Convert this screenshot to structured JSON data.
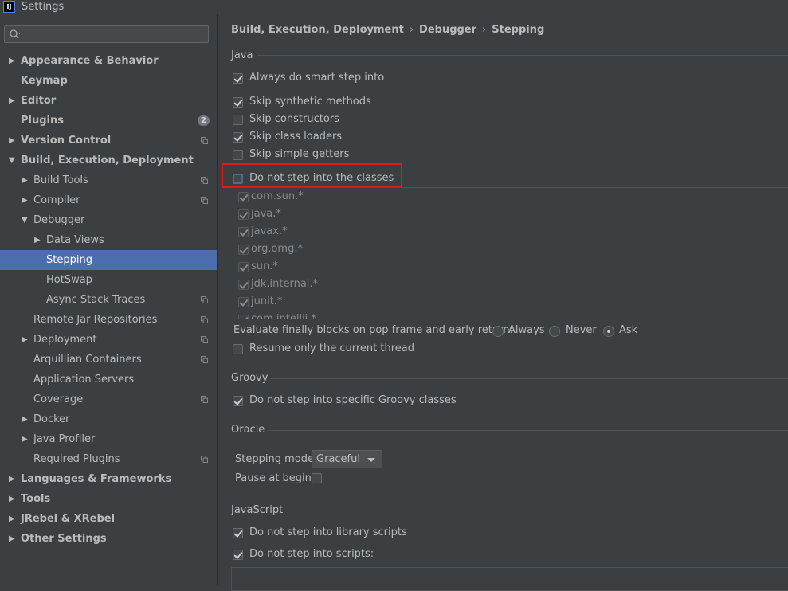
{
  "window": {
    "title": "Settings",
    "app_icon": "IJ"
  },
  "search": {
    "placeholder": ""
  },
  "sidebar": {
    "items": [
      {
        "label": "Appearance & Behavior",
        "bold": true,
        "arrow": "▶",
        "level": 0
      },
      {
        "label": "Keymap",
        "bold": true,
        "arrow": "",
        "level": 0
      },
      {
        "label": "Editor",
        "bold": true,
        "arrow": "▶",
        "level": 0
      },
      {
        "label": "Plugins",
        "bold": true,
        "arrow": "",
        "level": 0,
        "badge": "2"
      },
      {
        "label": "Version Control",
        "bold": true,
        "arrow": "▶",
        "level": 0,
        "copy": true
      },
      {
        "label": "Build, Execution, Deployment",
        "bold": true,
        "arrow": "▼",
        "level": 0
      },
      {
        "label": "Build Tools",
        "bold": false,
        "arrow": "▶",
        "level": 1,
        "copy": true
      },
      {
        "label": "Compiler",
        "bold": false,
        "arrow": "▶",
        "level": 1,
        "copy": true
      },
      {
        "label": "Debugger",
        "bold": false,
        "arrow": "▼",
        "level": 1
      },
      {
        "label": "Data Views",
        "bold": false,
        "arrow": "▶",
        "level": 2
      },
      {
        "label": "Stepping",
        "bold": false,
        "arrow": "",
        "level": 2,
        "selected": true
      },
      {
        "label": "HotSwap",
        "bold": false,
        "arrow": "",
        "level": 2
      },
      {
        "label": "Async Stack Traces",
        "bold": false,
        "arrow": "",
        "level": 2,
        "copy": true
      },
      {
        "label": "Remote Jar Repositories",
        "bold": false,
        "arrow": "",
        "level": 1,
        "copy": true
      },
      {
        "label": "Deployment",
        "bold": false,
        "arrow": "▶",
        "level": 1,
        "copy": true
      },
      {
        "label": "Arquillian Containers",
        "bold": false,
        "arrow": "",
        "level": 1,
        "copy": true
      },
      {
        "label": "Application Servers",
        "bold": false,
        "arrow": "",
        "level": 1
      },
      {
        "label": "Coverage",
        "bold": false,
        "arrow": "",
        "level": 1,
        "copy": true
      },
      {
        "label": "Docker",
        "bold": false,
        "arrow": "▶",
        "level": 1
      },
      {
        "label": "Java Profiler",
        "bold": false,
        "arrow": "▶",
        "level": 1
      },
      {
        "label": "Required Plugins",
        "bold": false,
        "arrow": "",
        "level": 1,
        "copy": true
      },
      {
        "label": "Languages & Frameworks",
        "bold": true,
        "arrow": "▶",
        "level": 0
      },
      {
        "label": "Tools",
        "bold": true,
        "arrow": "▶",
        "level": 0
      },
      {
        "label": "JRebel & XRebel",
        "bold": true,
        "arrow": "▶",
        "level": 0
      },
      {
        "label": "Other Settings",
        "bold": true,
        "arrow": "▶",
        "level": 0
      }
    ]
  },
  "breadcrumb": {
    "part1": "Build, Execution, Deployment",
    "part2": "Debugger",
    "part3": "Stepping",
    "sep": "›"
  },
  "java": {
    "title": "Java",
    "smart_step": {
      "label": "Always do smart step into",
      "checked": true
    },
    "skip_synthetic": {
      "label": "Skip synthetic methods",
      "checked": true
    },
    "skip_constructors": {
      "label": "Skip constructors",
      "checked": false
    },
    "skip_class_loaders": {
      "label": "Skip class loaders",
      "checked": true
    },
    "skip_simple_getters": {
      "label": "Skip simple getters",
      "checked": false
    },
    "do_not_step_classes": {
      "label": "Do not step into the classes",
      "checked": false
    },
    "classes": [
      "com.sun.*",
      "java.*",
      "javax.*",
      "org.omg.*",
      "sun.*",
      "jdk.internal.*",
      "junit.*",
      "com.intellij.*"
    ],
    "evaluate_label": "Evaluate finally blocks on pop frame and early return:",
    "radio_always": "Always",
    "radio_never": "Never",
    "radio_ask": "Ask",
    "resume_thread": {
      "label": "Resume only the current thread",
      "checked": false
    }
  },
  "groovy": {
    "title": "Groovy",
    "specific_classes": {
      "label": "Do not step into specific Groovy classes",
      "checked": true
    }
  },
  "oracle": {
    "title": "Oracle",
    "stepping_mode_label": "Stepping mode:",
    "stepping_mode_value": "Graceful",
    "pause_label": "Pause at begin:"
  },
  "javascript": {
    "title": "JavaScript",
    "library_scripts": {
      "label": "Do not step into library scripts",
      "checked": true
    },
    "scripts": {
      "label": "Do not step into scripts:",
      "checked": true
    }
  },
  "colors": {
    "selection": "#4b6eaf",
    "highlight": "#e41a1a",
    "background": "#3c3f41"
  }
}
